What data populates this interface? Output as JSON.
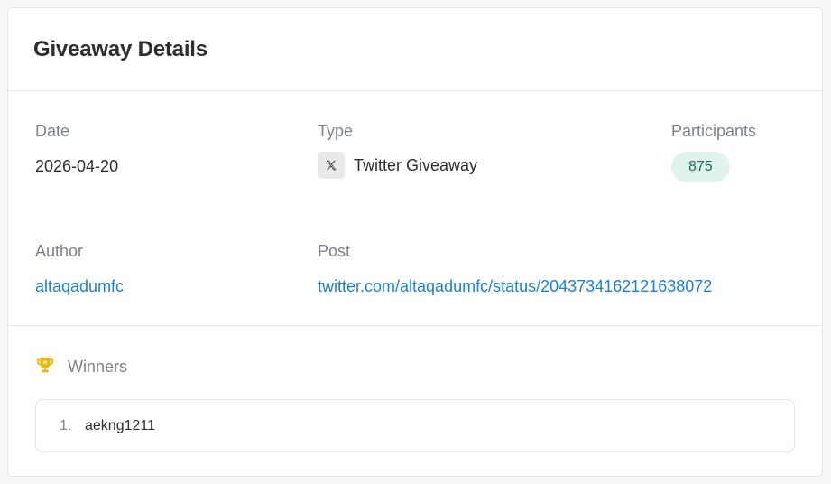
{
  "card": {
    "title": "Giveaway Details"
  },
  "details": {
    "date": {
      "label": "Date",
      "value": "2026-04-20"
    },
    "type": {
      "label": "Type",
      "value": "Twitter Giveaway",
      "icon": "x-logo-icon"
    },
    "participants": {
      "label": "Participants",
      "value": "875"
    },
    "author": {
      "label": "Author",
      "value": "altaqadumfc"
    },
    "post": {
      "label": "Post",
      "value": "twitter.com/altaqadumfc/status/2043734162121638072"
    }
  },
  "winners": {
    "title": "Winners",
    "icon": "trophy-icon",
    "items": [
      {
        "rank": "1.",
        "name": "aekng1211"
      }
    ]
  },
  "colors": {
    "link": "#1a7fd9",
    "badge_bg": "#dff5ec",
    "badge_text": "#1c6b4a",
    "trophy": "#e5b80b"
  }
}
